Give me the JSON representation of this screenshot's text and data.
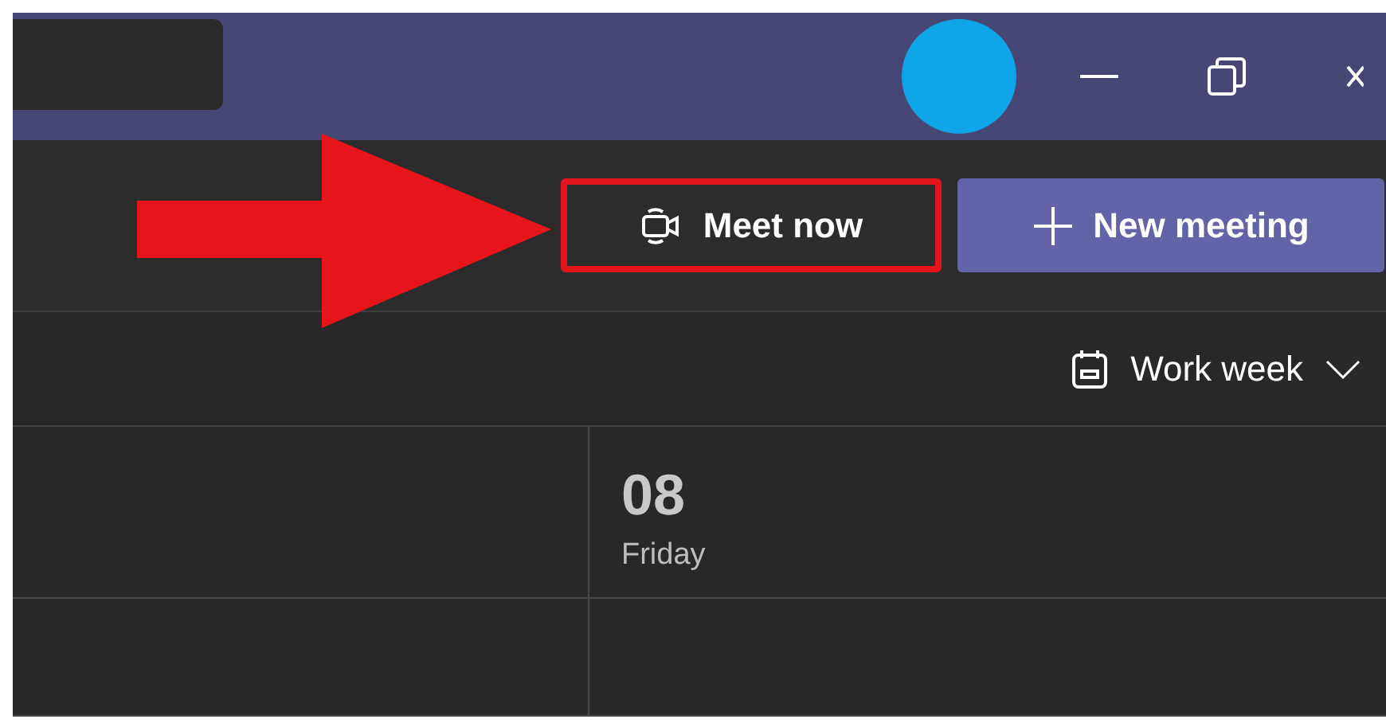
{
  "title_bar": {
    "search": {
      "kind": "field"
    },
    "avatar": {
      "color": "#0ea5e9"
    },
    "window_controls": [
      {
        "kind": "minimize"
      },
      {
        "kind": "restore"
      },
      {
        "kind": "close"
      }
    ]
  },
  "toolbar": {
    "buttons": [
      {
        "label": "Meet now",
        "kind": "meet",
        "highlighted": true
      },
      {
        "label": "New meeting",
        "kind": "new",
        "highlighted": false
      }
    ],
    "annotations": [
      {
        "kind": "arrow"
      }
    ]
  },
  "view_selector": {
    "label": "Work week"
  },
  "days": [
    {
      "number": "08",
      "name": "Friday"
    }
  ]
}
